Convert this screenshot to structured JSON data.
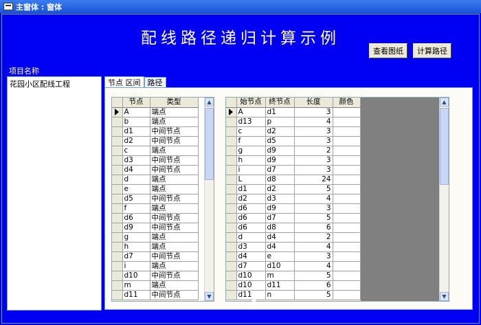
{
  "window": {
    "title": "主窗体 : 窗体"
  },
  "heading": "配线路径递归计算示例",
  "buttons": {
    "view_drawing": "查看图纸",
    "calc_path": "计算路径"
  },
  "project": {
    "label": "项目名称",
    "items": [
      "花园小区配线工程"
    ]
  },
  "tabs": [
    {
      "label": "节点 区间",
      "active": true
    },
    {
      "label": "路径",
      "active": false
    }
  ],
  "node_table": {
    "headers": [
      "节点",
      "类型"
    ],
    "rows": [
      [
        "A",
        "端点"
      ],
      [
        "b",
        "端点"
      ],
      [
        "d1",
        "中间节点"
      ],
      [
        "d2",
        "中间节点"
      ],
      [
        "c",
        "端点"
      ],
      [
        "d3",
        "中间节点"
      ],
      [
        "d4",
        "中间节点"
      ],
      [
        "d",
        "端点"
      ],
      [
        "e",
        "端点"
      ],
      [
        "d5",
        "中间节点"
      ],
      [
        "f",
        "端点"
      ],
      [
        "d6",
        "中间节点"
      ],
      [
        "d9",
        "中间节点"
      ],
      [
        "g",
        "端点"
      ],
      [
        "h",
        "端点"
      ],
      [
        "d7",
        "中间节点"
      ],
      [
        "i",
        "端点"
      ],
      [
        "d10",
        "中间节点"
      ],
      [
        "m",
        "端点"
      ],
      [
        "d11",
        "中间节点"
      ]
    ]
  },
  "segment_table": {
    "headers": [
      "始节点",
      "终节点",
      "长度",
      "颜色"
    ],
    "rows": [
      [
        "A",
        "d1",
        "3",
        ""
      ],
      [
        "d13",
        "p",
        "4",
        ""
      ],
      [
        "c",
        "d2",
        "3",
        ""
      ],
      [
        "f",
        "d5",
        "3",
        ""
      ],
      [
        "g",
        "d9",
        "2",
        ""
      ],
      [
        "h",
        "d9",
        "3",
        ""
      ],
      [
        "i",
        "d7",
        "3",
        ""
      ],
      [
        "L",
        "d8",
        "24",
        ""
      ],
      [
        "d1",
        "d2",
        "5",
        ""
      ],
      [
        "d2",
        "d3",
        "4",
        ""
      ],
      [
        "d6",
        "d9",
        "3",
        ""
      ],
      [
        "d6",
        "d7",
        "5",
        ""
      ],
      [
        "d6",
        "d8",
        "6",
        ""
      ],
      [
        "d",
        "d4",
        "2",
        ""
      ],
      [
        "d3",
        "d4",
        "4",
        ""
      ],
      [
        "d4",
        "e",
        "3",
        ""
      ],
      [
        "d7",
        "d10",
        "4",
        ""
      ],
      [
        "d10",
        "m",
        "5",
        ""
      ],
      [
        "d10",
        "d11",
        "6",
        ""
      ],
      [
        "d11",
        "n",
        "5",
        ""
      ]
    ]
  },
  "icons": {
    "window": "form-icon",
    "record_pointer": "record-pointer-icon",
    "scroll_up": "arrow-up-icon",
    "scroll_down": "arrow-down-icon"
  }
}
